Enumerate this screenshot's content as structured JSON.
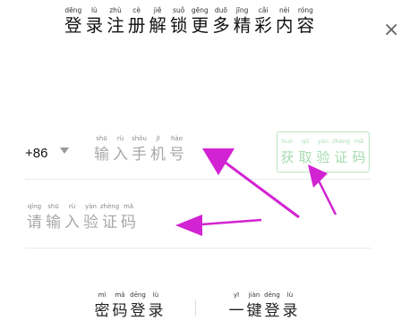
{
  "header": {
    "title_chars": [
      {
        "py": "dēng",
        "hz": "登"
      },
      {
        "py": "lù",
        "hz": "录"
      },
      {
        "py": "zhù",
        "hz": "注"
      },
      {
        "py": "cè",
        "hz": "册"
      },
      {
        "py": "jiě",
        "hz": "解"
      },
      {
        "py": "suǒ",
        "hz": "锁"
      },
      {
        "py": "gēng",
        "hz": "更"
      },
      {
        "py": "duō",
        "hz": "多"
      },
      {
        "py": "jīng",
        "hz": "精"
      },
      {
        "py": "cǎi",
        "hz": "彩"
      },
      {
        "py": "nèi",
        "hz": "内"
      },
      {
        "py": "róng",
        "hz": "容"
      }
    ],
    "close_glyph": "×"
  },
  "phone": {
    "country_code": "+86",
    "placeholder_chars": [
      {
        "py": "shū",
        "hz": "输"
      },
      {
        "py": "rù",
        "hz": "入"
      },
      {
        "py": "shǒu",
        "hz": "手"
      },
      {
        "py": "jī",
        "hz": "机"
      },
      {
        "py": "hào",
        "hz": "号"
      }
    ],
    "get_code_chars": [
      {
        "py": "huò",
        "hz": "获"
      },
      {
        "py": "qǔ",
        "hz": "取"
      },
      {
        "py": "yàn",
        "hz": "验"
      },
      {
        "py": "zhèng",
        "hz": "证"
      },
      {
        "py": "mǎ",
        "hz": "码"
      }
    ]
  },
  "code": {
    "placeholder_chars": [
      {
        "py": "qǐng",
        "hz": "请"
      },
      {
        "py": "shū",
        "hz": "输"
      },
      {
        "py": "rù",
        "hz": "入"
      },
      {
        "py": "yàn",
        "hz": "验"
      },
      {
        "py": "zhèng",
        "hz": "证"
      },
      {
        "py": "mǎ",
        "hz": "码"
      }
    ]
  },
  "footer": {
    "password_login_chars": [
      {
        "py": "mì",
        "hz": "密"
      },
      {
        "py": "mǎ",
        "hz": "码"
      },
      {
        "py": "dēng",
        "hz": "登"
      },
      {
        "py": "lù",
        "hz": "录"
      }
    ],
    "one_click_login_chars": [
      {
        "py": "yī",
        "hz": "一"
      },
      {
        "py": "jiàn",
        "hz": "键"
      },
      {
        "py": "dēng",
        "hz": "登"
      },
      {
        "py": "lù",
        "hz": "录"
      }
    ]
  },
  "annotation": {
    "arrow_color": "#d223d2"
  }
}
